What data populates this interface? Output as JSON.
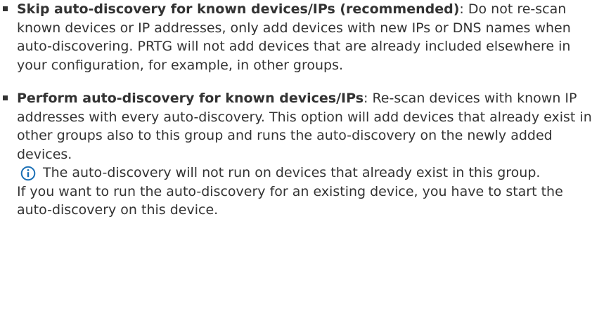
{
  "options": [
    {
      "title": "Skip auto-discovery for known devices/IPs (recommended)",
      "separator": ":",
      "description": " Do not re-scan known devices or IP addresses, only add devices with new IPs or DNS names when auto-discovering. PRTG will not add devices that are already included elsewhere in your configuration, for example, in other groups."
    },
    {
      "title": "Perform auto-discovery for known devices/IPs",
      "separator": ":",
      "description": " Re-scan devices with known IP addresses with every auto-discovery. This option will add devices that already exist in other groups also to this group and runs the auto-discovery on the newly added devices.",
      "note": {
        "icon": "info-icon",
        "first_line": "The auto-discovery will not run on devices that already exist in this group.",
        "rest": " If you want to run the auto-discovery for an existing device, you have to start the auto-discovery on this device."
      }
    }
  ],
  "colors": {
    "text": "#333333",
    "icon": "#1a6fb5"
  }
}
